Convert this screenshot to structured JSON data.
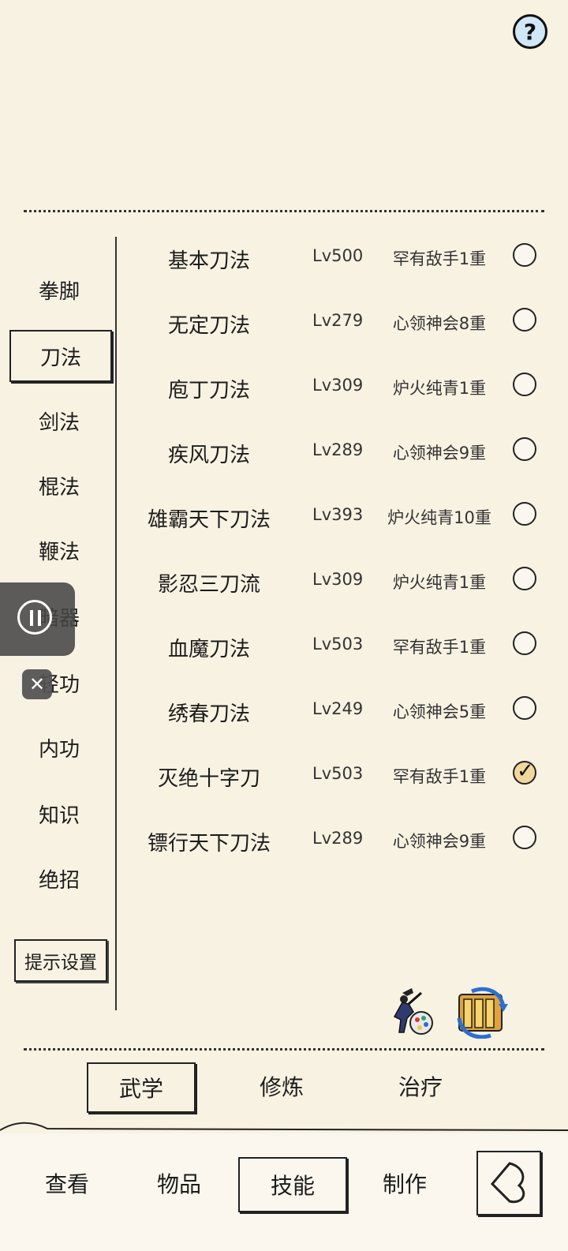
{
  "sidebar": {
    "items": [
      {
        "label": "拳脚"
      },
      {
        "label": "刀法"
      },
      {
        "label": "剑法"
      },
      {
        "label": "棍法"
      },
      {
        "label": "鞭法"
      },
      {
        "label": "暗器"
      },
      {
        "label": "轻功"
      },
      {
        "label": "内功"
      },
      {
        "label": "知识"
      },
      {
        "label": "绝招"
      }
    ],
    "active": "刀法",
    "hint_button": "提示设置"
  },
  "skills": [
    {
      "name": "基本刀法",
      "level": "Lv500",
      "rank": "罕有敌手1重",
      "checked": false
    },
    {
      "name": "无定刀法",
      "level": "Lv279",
      "rank": "心领神会8重",
      "checked": false
    },
    {
      "name": "庖丁刀法",
      "level": "Lv309",
      "rank": "炉火纯青1重",
      "checked": false
    },
    {
      "name": "疾风刀法",
      "level": "Lv289",
      "rank": "心领神会9重",
      "checked": false
    },
    {
      "name": "雄霸天下刀法",
      "level": "Lv393",
      "rank": "炉火纯青10重",
      "checked": false
    },
    {
      "name": "影忍三刀流",
      "level": "Lv309",
      "rank": "炉火纯青1重",
      "checked": false
    },
    {
      "name": "血魔刀法",
      "level": "Lv503",
      "rank": "罕有敌手1重",
      "checked": false
    },
    {
      "name": "绣春刀法",
      "level": "Lv249",
      "rank": "心领神会5重",
      "checked": false
    },
    {
      "name": "灭绝十字刀",
      "level": "Lv503",
      "rank": "罕有敌手1重",
      "checked": true
    },
    {
      "name": "镖行天下刀法",
      "level": "Lv289",
      "rank": "心领神会9重",
      "checked": false
    }
  ],
  "subtabs": [
    {
      "label": "武学"
    },
    {
      "label": "修炼"
    },
    {
      "label": "治疗"
    }
  ],
  "active_subtab": "武学",
  "nav": [
    {
      "label": "查看"
    },
    {
      "label": "物品"
    },
    {
      "label": "技能"
    },
    {
      "label": "制作"
    }
  ],
  "active_nav": "技能",
  "icons": {
    "help": "question-mark-icon",
    "martial_artist": "martial-artist-palette-icon",
    "swap": "swap-scroll-icon",
    "back": "back-arrow-icon",
    "pause": "pause-icon",
    "close": "close-icon"
  },
  "colors": {
    "background": "#f8f2e2",
    "checked_radio": "#f1d79c",
    "help_icon_fill": "#cfe7f6"
  }
}
